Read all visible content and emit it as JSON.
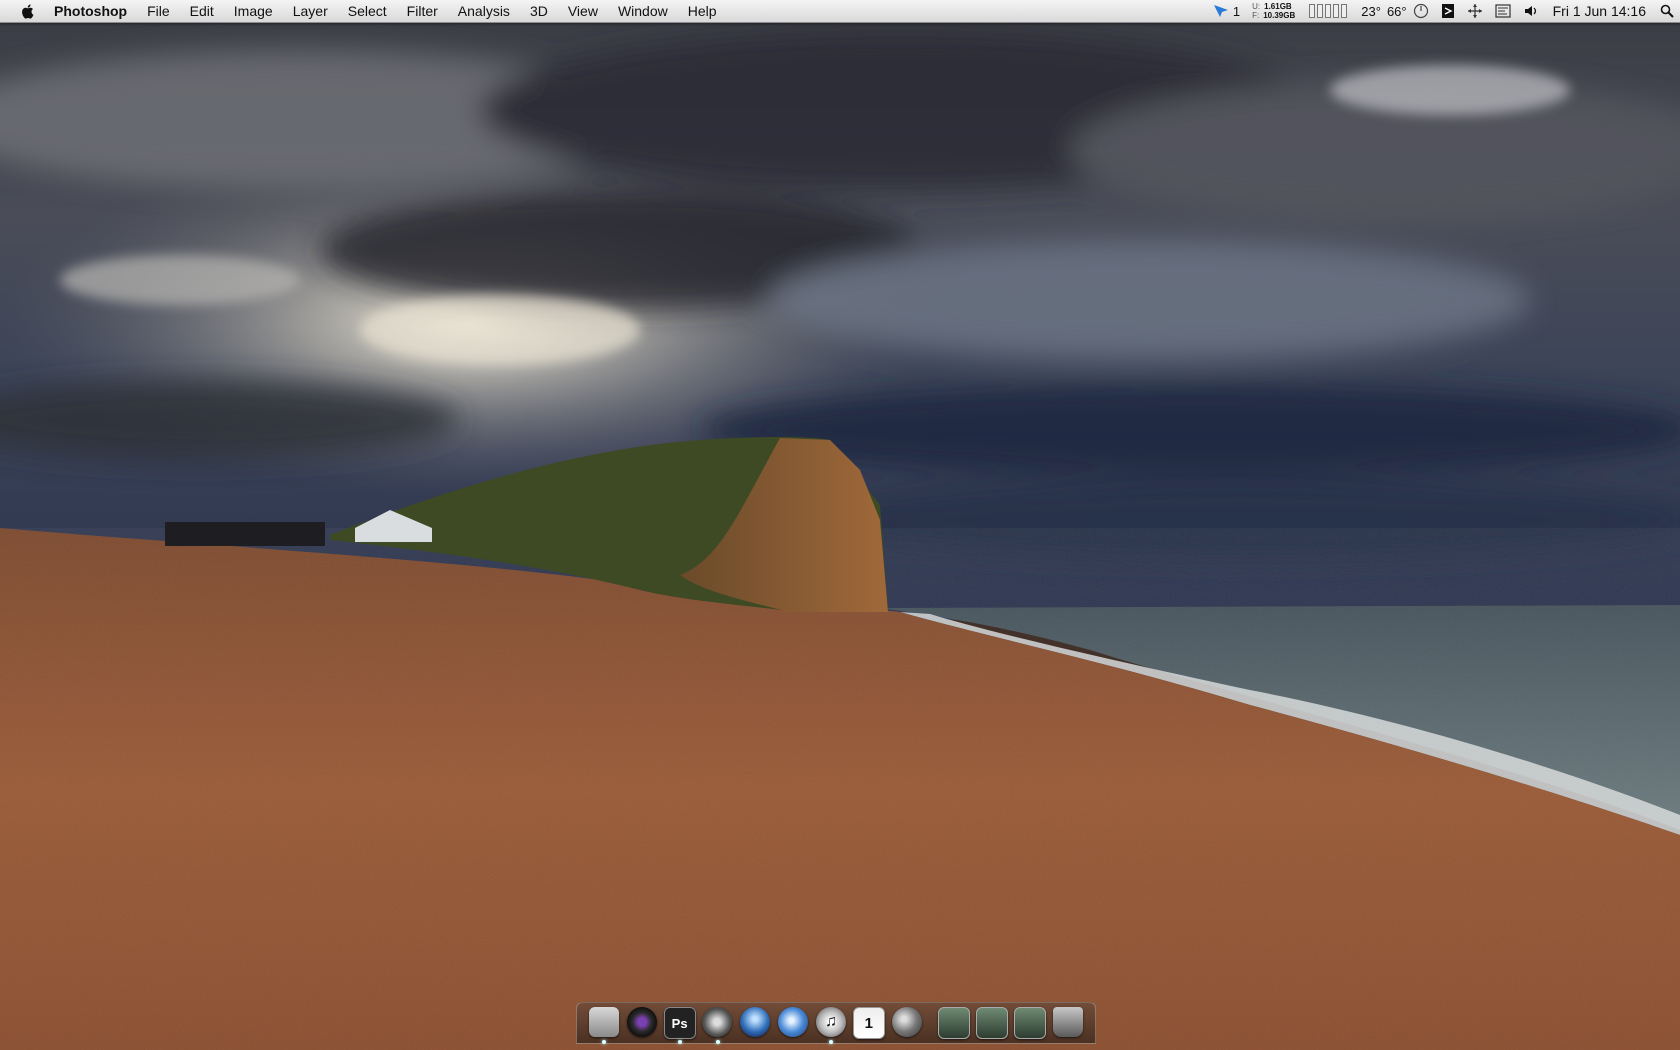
{
  "menubar": {
    "app_name": "Photoshop",
    "menus": [
      "File",
      "Edit",
      "Image",
      "Layer",
      "Select",
      "Filter",
      "Analysis",
      "3D",
      "View",
      "Window",
      "Help"
    ],
    "status": {
      "spaces": "1",
      "memory": {
        "used_key": "U:",
        "used": "1.61GB",
        "free_key": "F:",
        "free": "10.39GB"
      },
      "temp": "23°",
      "fan": "66°",
      "clock": "Fri 1 Jun  14:16"
    }
  },
  "dock": {
    "items": [
      {
        "name": "finder",
        "running": true
      },
      {
        "name": "aperture",
        "running": false
      },
      {
        "name": "photoshop",
        "label": "Ps",
        "running": true
      },
      {
        "name": "safari",
        "running": true
      },
      {
        "name": "mail",
        "running": false
      },
      {
        "name": "system-preferences",
        "running": false
      },
      {
        "name": "itunes",
        "running": true
      },
      {
        "name": "ical",
        "label": "1",
        "running": false
      },
      {
        "name": "time-machine",
        "running": false
      }
    ],
    "stacks": [
      "downloads-stack",
      "documents-stack",
      "applications-stack"
    ],
    "trash": "trash"
  },
  "colors": {
    "menubar": "#e6e6e6",
    "sky_dark": "#2d3142",
    "sand": "#9a5a36",
    "sea": "#5a6a70"
  }
}
